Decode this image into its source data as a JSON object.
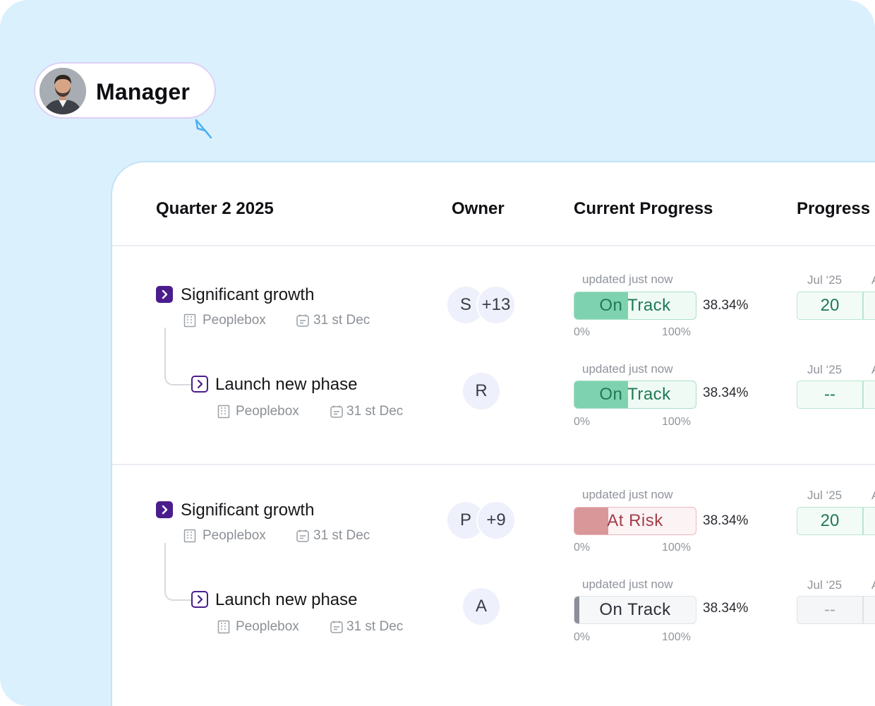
{
  "manager": {
    "label": "Manager"
  },
  "table": {
    "headers": {
      "quarter": "Quarter 2 2025",
      "owner": "Owner",
      "current_progress": "Current Progress",
      "progress": "Progress"
    },
    "groups": [
      {
        "parent": {
          "title": "Significant growth",
          "workspace": "Peoplebox",
          "due": "31 st Dec",
          "owner": {
            "initial": "S",
            "extra": "+13"
          },
          "updated": "updated just now",
          "status": "On Track",
          "progress_fraction": 0.44,
          "percent": "38.34%",
          "scale_min": "0%",
          "scale_max": "100%",
          "month": "Jul ‘25",
          "month_next": "A",
          "value": "20"
        },
        "child": {
          "title": "Launch new phase",
          "workspace": "Peoplebox",
          "due": "31 st Dec",
          "owner": {
            "initial": "R"
          },
          "updated": "updated just now",
          "status": "On Track",
          "progress_fraction": 0.44,
          "percent": "38.34%",
          "scale_min": "0%",
          "scale_max": "100%",
          "month": "Jul ‘25",
          "month_next": "A",
          "value": "--"
        }
      },
      {
        "parent": {
          "title": "Significant growth",
          "workspace": "Peoplebox",
          "due": "31 st Dec",
          "owner": {
            "initial": "P",
            "extra": "+9"
          },
          "updated": "updated just now",
          "status": "At Risk",
          "progress_fraction": 0.28,
          "percent": "38.34%",
          "scale_min": "0%",
          "scale_max": "100%",
          "month": "Jul ‘25",
          "month_next": "A",
          "value": "20"
        },
        "child": {
          "title": "Launch new phase",
          "workspace": "Peoplebox",
          "due": "31 st Dec",
          "owner": {
            "initial": "A"
          },
          "updated": "updated just now",
          "status": "On Track",
          "progress_fraction": 0.04,
          "percent": "38.34%",
          "scale_min": "0%",
          "scale_max": "100%",
          "month": "Jul ‘25",
          "month_next": "A",
          "value": "--"
        }
      }
    ]
  },
  "colors": {
    "background": "#dbf0fd",
    "accent_purple": "#4b1d8c",
    "on_track_fill": "#7fd2b0",
    "on_track_text": "#1f7a55",
    "at_risk_fill": "#d9979a",
    "at_risk_text": "#a33f4a",
    "neutral_fill": "#8b8f98"
  },
  "icons": [
    "person-avatar",
    "cursor-arrow-icon",
    "chevron-right-icon",
    "building-icon",
    "calendar-icon"
  ]
}
